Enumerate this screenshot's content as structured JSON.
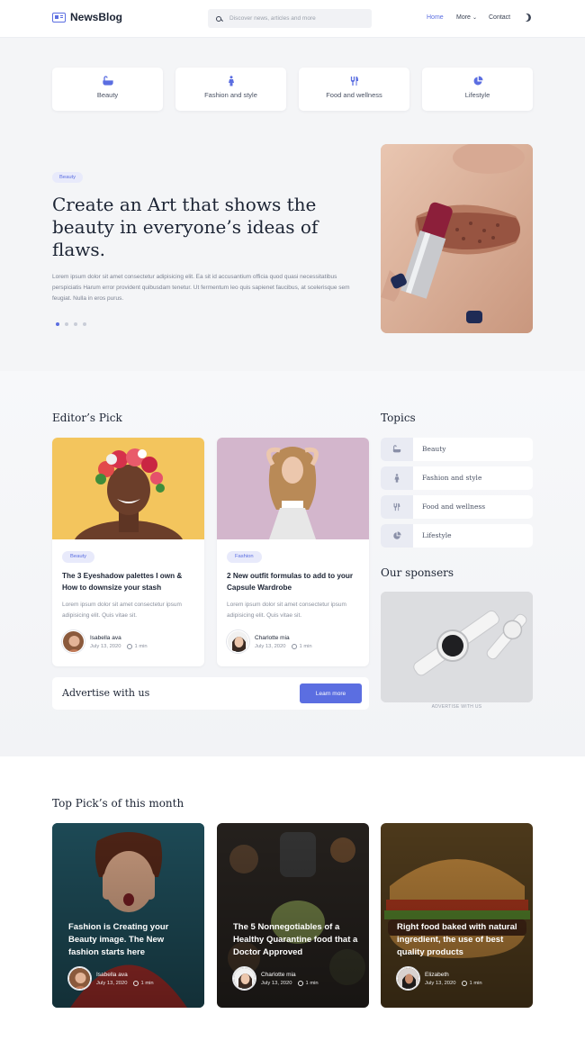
{
  "header": {
    "brand": "NewsBlog",
    "search_placeholder": "Discover news, articles and more",
    "nav": {
      "home": "Home",
      "more": "More",
      "contact": "Contact"
    }
  },
  "categories": [
    {
      "label": "Beauty",
      "icon": "bathtub-icon"
    },
    {
      "label": "Fashion and style",
      "icon": "person-icon"
    },
    {
      "label": "Food and wellness",
      "icon": "cutlery-icon"
    },
    {
      "label": "Lifestyle",
      "icon": "pie-chart-icon"
    }
  ],
  "hero": {
    "badge": "Beauty",
    "title": "Create an Art that shows the beauty in everyone’s ideas of flaws.",
    "text": "Lorem ipsum dolor sit amet consectetur adipisicing elit. Ea sit id accusantium officia quod quasi necessitatibus perspiciatis Harum error provident quibusdam tenetur. Ut fermentum leo quis sapienet faucibus, at scelerisque sem feugiat. Nulla in eros purus.",
    "slides": 4,
    "active_slide": 1
  },
  "editors_pick": {
    "title": "Editor’s Pick",
    "cards": [
      {
        "badge": "Beauty",
        "title": "The 3 Eyeshadow palettes I own & How to downsize your stash",
        "text": "Lorem ipsum dolor sit amet consectetur ipsum adipisicing elit. Quis vitae sit.",
        "author": "Isabella ava",
        "date": "July 13, 2020",
        "read": "1 min"
      },
      {
        "badge": "Fashion",
        "title": "2 New outfit formulas to add to your Capsule Wardrobe",
        "text": "Lorem ipsum dolor sit amet consectetur ipsum adipisicing elit. Quis vitae sit.",
        "author": "Charlotte mia",
        "date": "July 13, 2020",
        "read": "1 min"
      }
    ]
  },
  "advertise": {
    "title": "Advertise with us",
    "button": "Learn more"
  },
  "topics": {
    "title": "Topics",
    "items": [
      {
        "label": "Beauty",
        "icon": "bathtub-icon"
      },
      {
        "label": "Fashion and style",
        "icon": "person-icon"
      },
      {
        "label": "Food and wellness",
        "icon": "cutlery-icon"
      },
      {
        "label": "Lifestyle",
        "icon": "pie-chart-icon"
      }
    ]
  },
  "sponsors": {
    "title": "Our sponsers",
    "caption": "ADVERTISE WITH US"
  },
  "top_picks": {
    "title": "Top Pick’s of this month",
    "cards": [
      {
        "title": "Fashion is Creating your Beauty image. The New fashion starts here",
        "author": "Isabella ava",
        "date": "July 13, 2020",
        "read": "1 min"
      },
      {
        "title": "The 5 Nonnegotiables of a Healthy Quarantine food that a Doctor Approved",
        "author": "Charlotte mia",
        "date": "July 13, 2020",
        "read": "1 min"
      },
      {
        "title": "Right food baked with natural ingredient, the use of best quality products",
        "author": "Elizabeth",
        "date": "July 13, 2020",
        "read": "1 min"
      }
    ]
  },
  "colors": {
    "accent": "#5b6ee1",
    "text": "#1c2434",
    "badge_bg": "#e8eafb"
  }
}
